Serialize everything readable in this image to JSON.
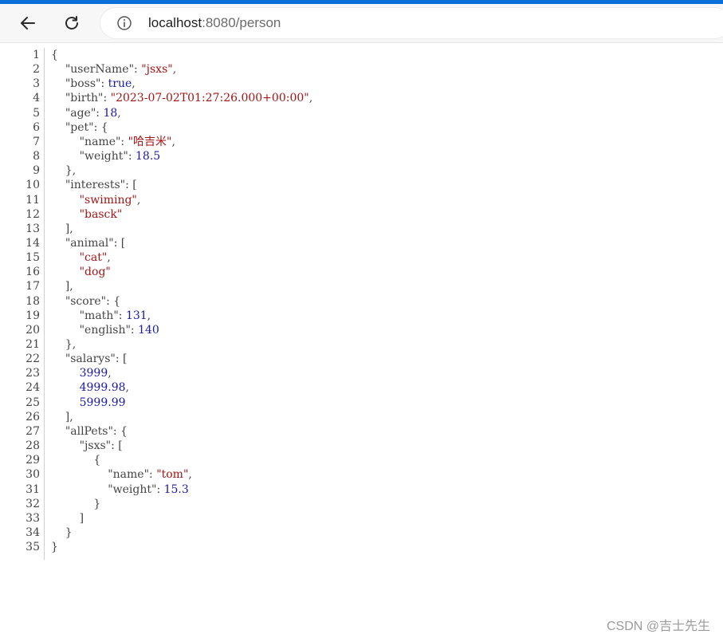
{
  "browser": {
    "url_host": "localhost",
    "url_path": ":8080/person"
  },
  "json_lines": [
    [
      {
        "t": "p",
        "v": "{"
      }
    ],
    [
      {
        "t": "p",
        "v": "    "
      },
      {
        "t": "k",
        "v": "\"userName\""
      },
      {
        "t": "p",
        "v": ": "
      },
      {
        "t": "s",
        "v": "\"jsxs\""
      },
      {
        "t": "p",
        "v": ","
      }
    ],
    [
      {
        "t": "p",
        "v": "    "
      },
      {
        "t": "k",
        "v": "\"boss\""
      },
      {
        "t": "p",
        "v": ": "
      },
      {
        "t": "b",
        "v": "true"
      },
      {
        "t": "p",
        "v": ","
      }
    ],
    [
      {
        "t": "p",
        "v": "    "
      },
      {
        "t": "k",
        "v": "\"birth\""
      },
      {
        "t": "p",
        "v": ": "
      },
      {
        "t": "s",
        "v": "\"2023-07-02T01:27:26.000+00:00\""
      },
      {
        "t": "p",
        "v": ","
      }
    ],
    [
      {
        "t": "p",
        "v": "    "
      },
      {
        "t": "k",
        "v": "\"age\""
      },
      {
        "t": "p",
        "v": ": "
      },
      {
        "t": "n",
        "v": "18"
      },
      {
        "t": "p",
        "v": ","
      }
    ],
    [
      {
        "t": "p",
        "v": "    "
      },
      {
        "t": "k",
        "v": "\"pet\""
      },
      {
        "t": "p",
        "v": ": {"
      }
    ],
    [
      {
        "t": "p",
        "v": "        "
      },
      {
        "t": "k",
        "v": "\"name\""
      },
      {
        "t": "p",
        "v": ": "
      },
      {
        "t": "s",
        "v": "\"哈吉米\""
      },
      {
        "t": "p",
        "v": ","
      }
    ],
    [
      {
        "t": "p",
        "v": "        "
      },
      {
        "t": "k",
        "v": "\"weight\""
      },
      {
        "t": "p",
        "v": ": "
      },
      {
        "t": "n",
        "v": "18.5"
      }
    ],
    [
      {
        "t": "p",
        "v": "    },"
      }
    ],
    [
      {
        "t": "p",
        "v": "    "
      },
      {
        "t": "k",
        "v": "\"interests\""
      },
      {
        "t": "p",
        "v": ": ["
      }
    ],
    [
      {
        "t": "p",
        "v": "        "
      },
      {
        "t": "s",
        "v": "\"swiming\""
      },
      {
        "t": "p",
        "v": ","
      }
    ],
    [
      {
        "t": "p",
        "v": "        "
      },
      {
        "t": "s",
        "v": "\"basck\""
      }
    ],
    [
      {
        "t": "p",
        "v": "    ],"
      }
    ],
    [
      {
        "t": "p",
        "v": "    "
      },
      {
        "t": "k",
        "v": "\"animal\""
      },
      {
        "t": "p",
        "v": ": ["
      }
    ],
    [
      {
        "t": "p",
        "v": "        "
      },
      {
        "t": "s",
        "v": "\"cat\""
      },
      {
        "t": "p",
        "v": ","
      }
    ],
    [
      {
        "t": "p",
        "v": "        "
      },
      {
        "t": "s",
        "v": "\"dog\""
      }
    ],
    [
      {
        "t": "p",
        "v": "    ],"
      }
    ],
    [
      {
        "t": "p",
        "v": "    "
      },
      {
        "t": "k",
        "v": "\"score\""
      },
      {
        "t": "p",
        "v": ": {"
      }
    ],
    [
      {
        "t": "p",
        "v": "        "
      },
      {
        "t": "k",
        "v": "\"math\""
      },
      {
        "t": "p",
        "v": ": "
      },
      {
        "t": "n",
        "v": "131"
      },
      {
        "t": "p",
        "v": ","
      }
    ],
    [
      {
        "t": "p",
        "v": "        "
      },
      {
        "t": "k",
        "v": "\"english\""
      },
      {
        "t": "p",
        "v": ": "
      },
      {
        "t": "n",
        "v": "140"
      }
    ],
    [
      {
        "t": "p",
        "v": "    },"
      }
    ],
    [
      {
        "t": "p",
        "v": "    "
      },
      {
        "t": "k",
        "v": "\"salarys\""
      },
      {
        "t": "p",
        "v": ": ["
      }
    ],
    [
      {
        "t": "p",
        "v": "        "
      },
      {
        "t": "n",
        "v": "3999"
      },
      {
        "t": "p",
        "v": ","
      }
    ],
    [
      {
        "t": "p",
        "v": "        "
      },
      {
        "t": "n",
        "v": "4999.98"
      },
      {
        "t": "p",
        "v": ","
      }
    ],
    [
      {
        "t": "p",
        "v": "        "
      },
      {
        "t": "n",
        "v": "5999.99"
      }
    ],
    [
      {
        "t": "p",
        "v": "    ],"
      }
    ],
    [
      {
        "t": "p",
        "v": "    "
      },
      {
        "t": "k",
        "v": "\"allPets\""
      },
      {
        "t": "p",
        "v": ": {"
      }
    ],
    [
      {
        "t": "p",
        "v": "        "
      },
      {
        "t": "k",
        "v": "\"jsxs\""
      },
      {
        "t": "p",
        "v": ": ["
      }
    ],
    [
      {
        "t": "p",
        "v": "            {"
      }
    ],
    [
      {
        "t": "p",
        "v": "                "
      },
      {
        "t": "k",
        "v": "\"name\""
      },
      {
        "t": "p",
        "v": ": "
      },
      {
        "t": "s",
        "v": "\"tom\""
      },
      {
        "t": "p",
        "v": ","
      }
    ],
    [
      {
        "t": "p",
        "v": "                "
      },
      {
        "t": "k",
        "v": "\"weight\""
      },
      {
        "t": "p",
        "v": ": "
      },
      {
        "t": "n",
        "v": "15.3"
      }
    ],
    [
      {
        "t": "p",
        "v": "            }"
      }
    ],
    [
      {
        "t": "p",
        "v": "        ]"
      }
    ],
    [
      {
        "t": "p",
        "v": "    }"
      }
    ],
    [
      {
        "t": "p",
        "v": "}"
      }
    ]
  ],
  "watermark": "CSDN @吉士先生",
  "colors": {
    "accent_strip": "#0a6fd8",
    "string": "#a31515",
    "number": "#1a1aa6",
    "punct": "#444444"
  },
  "icons": {
    "back": "arrow-left-icon",
    "reload": "reload-icon",
    "info": "info-icon"
  }
}
